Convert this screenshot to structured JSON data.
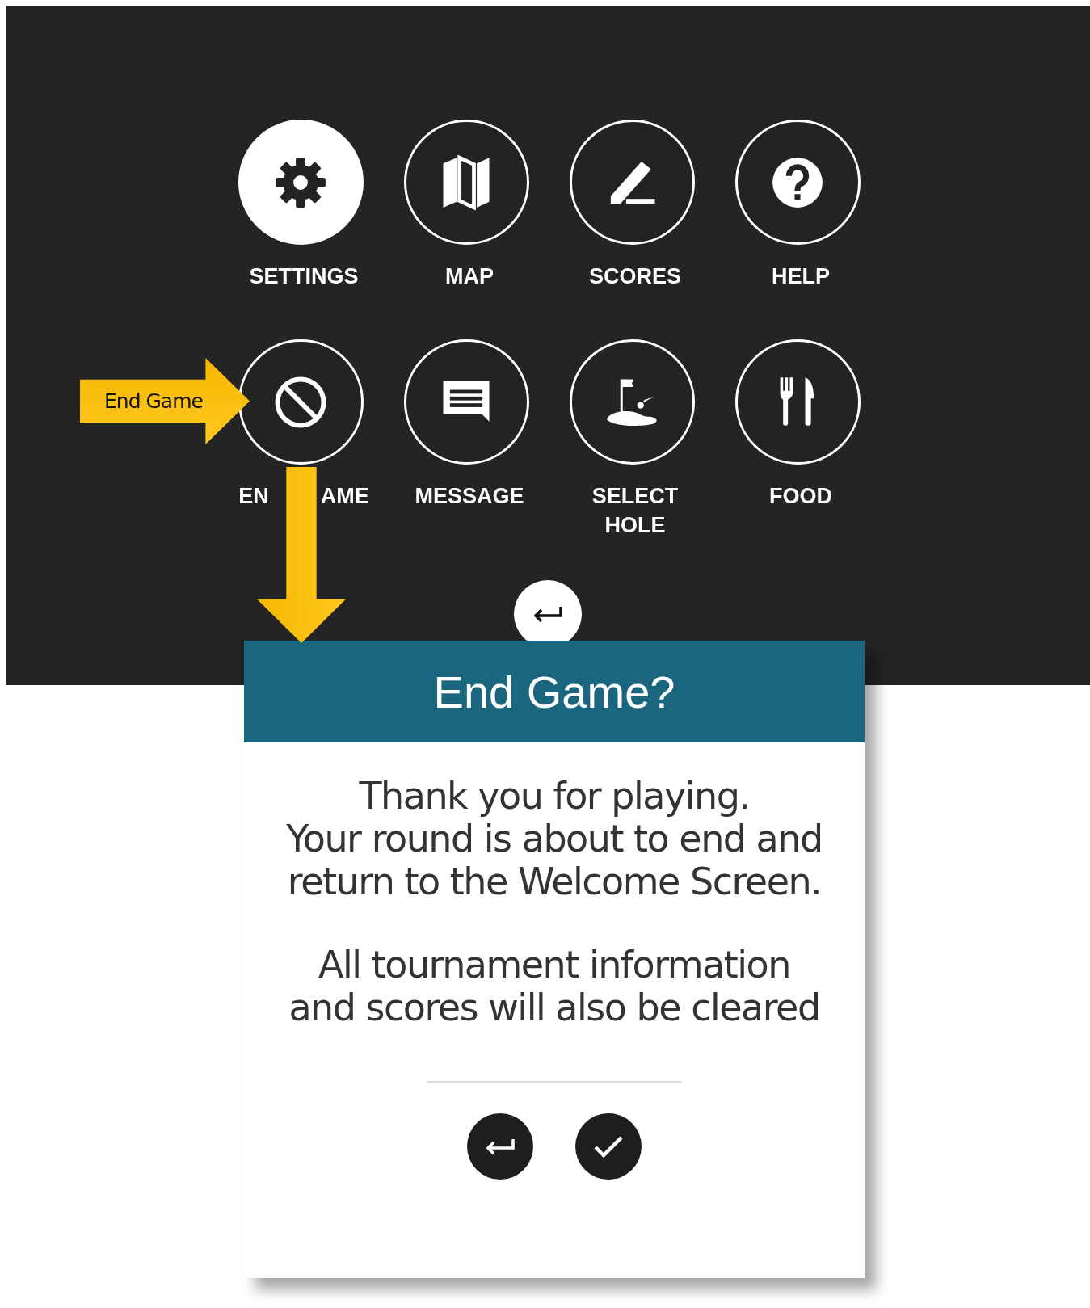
{
  "menu": {
    "items": [
      {
        "label_parts": [
          "SETTINGS"
        ],
        "selected": true
      },
      {
        "label_parts": [
          "MAP"
        ],
        "selected": false
      },
      {
        "label_parts": [
          "SCORES"
        ],
        "selected": false
      },
      {
        "label_parts": [
          "HELP"
        ],
        "selected": false
      },
      {
        "label_parts": [
          "EN",
          "AME"
        ],
        "selected": false
      },
      {
        "label_parts": [
          "MESSAGE"
        ],
        "selected": false
      },
      {
        "label_parts": [
          "SELECT HOLE"
        ],
        "selected": false
      },
      {
        "label_parts": [
          "FOOD"
        ],
        "selected": false
      }
    ]
  },
  "callout": {
    "text": "End Game"
  },
  "dialog": {
    "title": "End Game?",
    "paragraphs": [
      "Thank you for playing.\nYour round is about to end and\nreturn to the Welcome Screen.",
      "All tournament information\nand scores will also be cleared"
    ],
    "buttons": [
      {
        "kind": "back"
      },
      {
        "kind": "confirm"
      }
    ]
  }
}
